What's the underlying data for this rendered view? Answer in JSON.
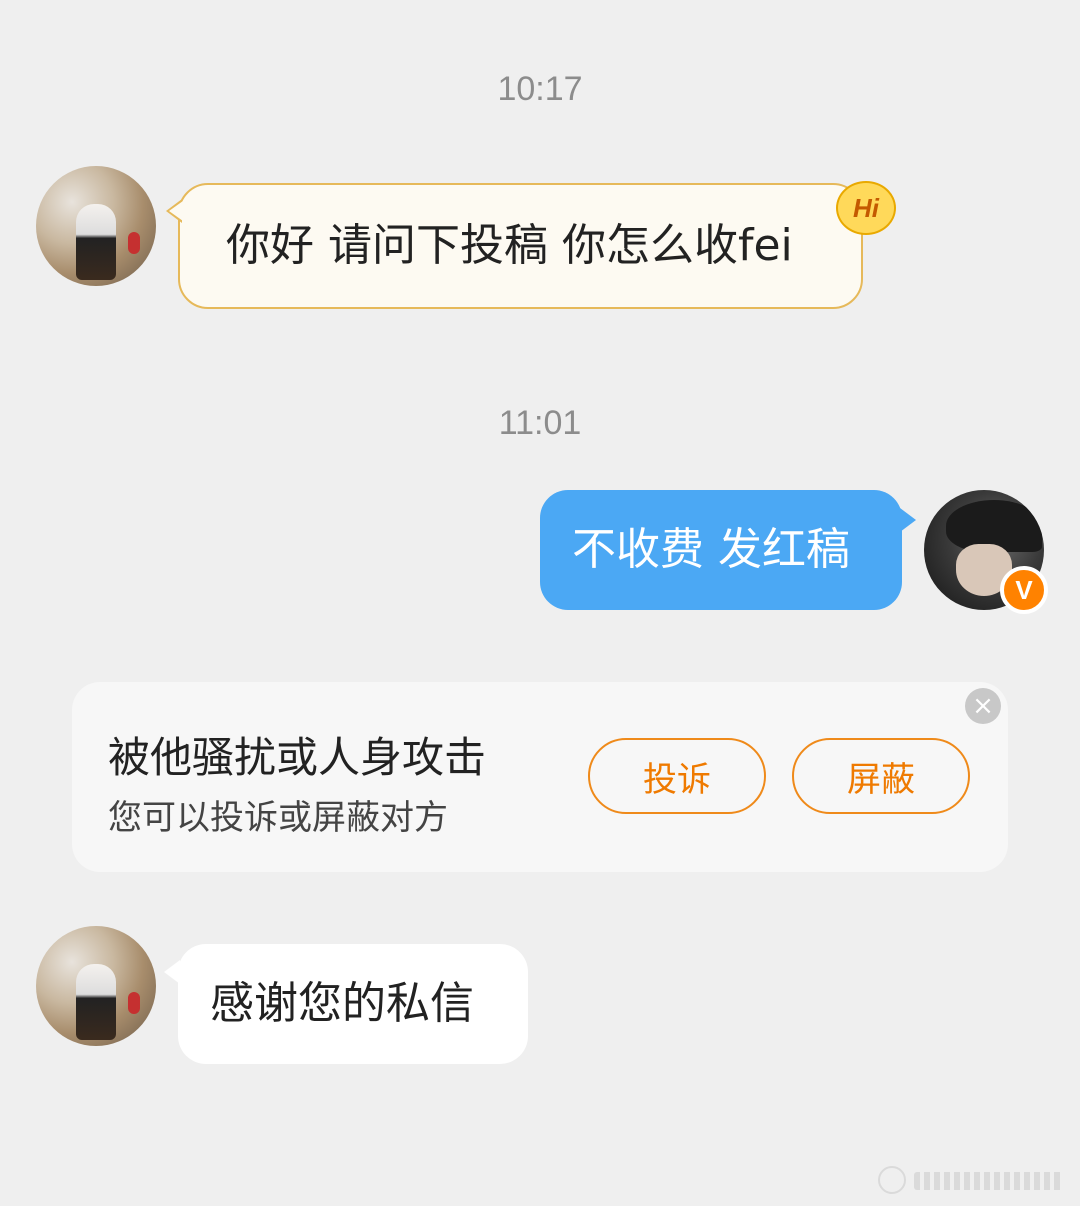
{
  "chat": {
    "timestamps": [
      "10:17",
      "11:01"
    ],
    "messages": [
      {
        "sender": "other",
        "text": "你好 请问下投稿 你怎么收fei",
        "badge": "Hi"
      },
      {
        "sender": "self",
        "text": "不收费 发红稿",
        "verified_badge": "V"
      },
      {
        "sender": "other",
        "text": "感谢您的私信"
      }
    ]
  },
  "harassment_card": {
    "title": "被他骚扰或人身攻击",
    "subtitle": "您可以投诉或屏蔽对方",
    "report_label": "投诉",
    "block_label": "屏蔽",
    "close_icon": "×"
  },
  "icons": {
    "close": "close-icon",
    "verified": "verified-badge-icon",
    "hi": "hi-badge-icon"
  },
  "colors": {
    "background": "#efefef",
    "self_bubble": "#4ba8f4",
    "hi_bubble": "#fdfaf2",
    "hi_border": "#e6b95a",
    "accent_orange": "#ef8a1a"
  }
}
